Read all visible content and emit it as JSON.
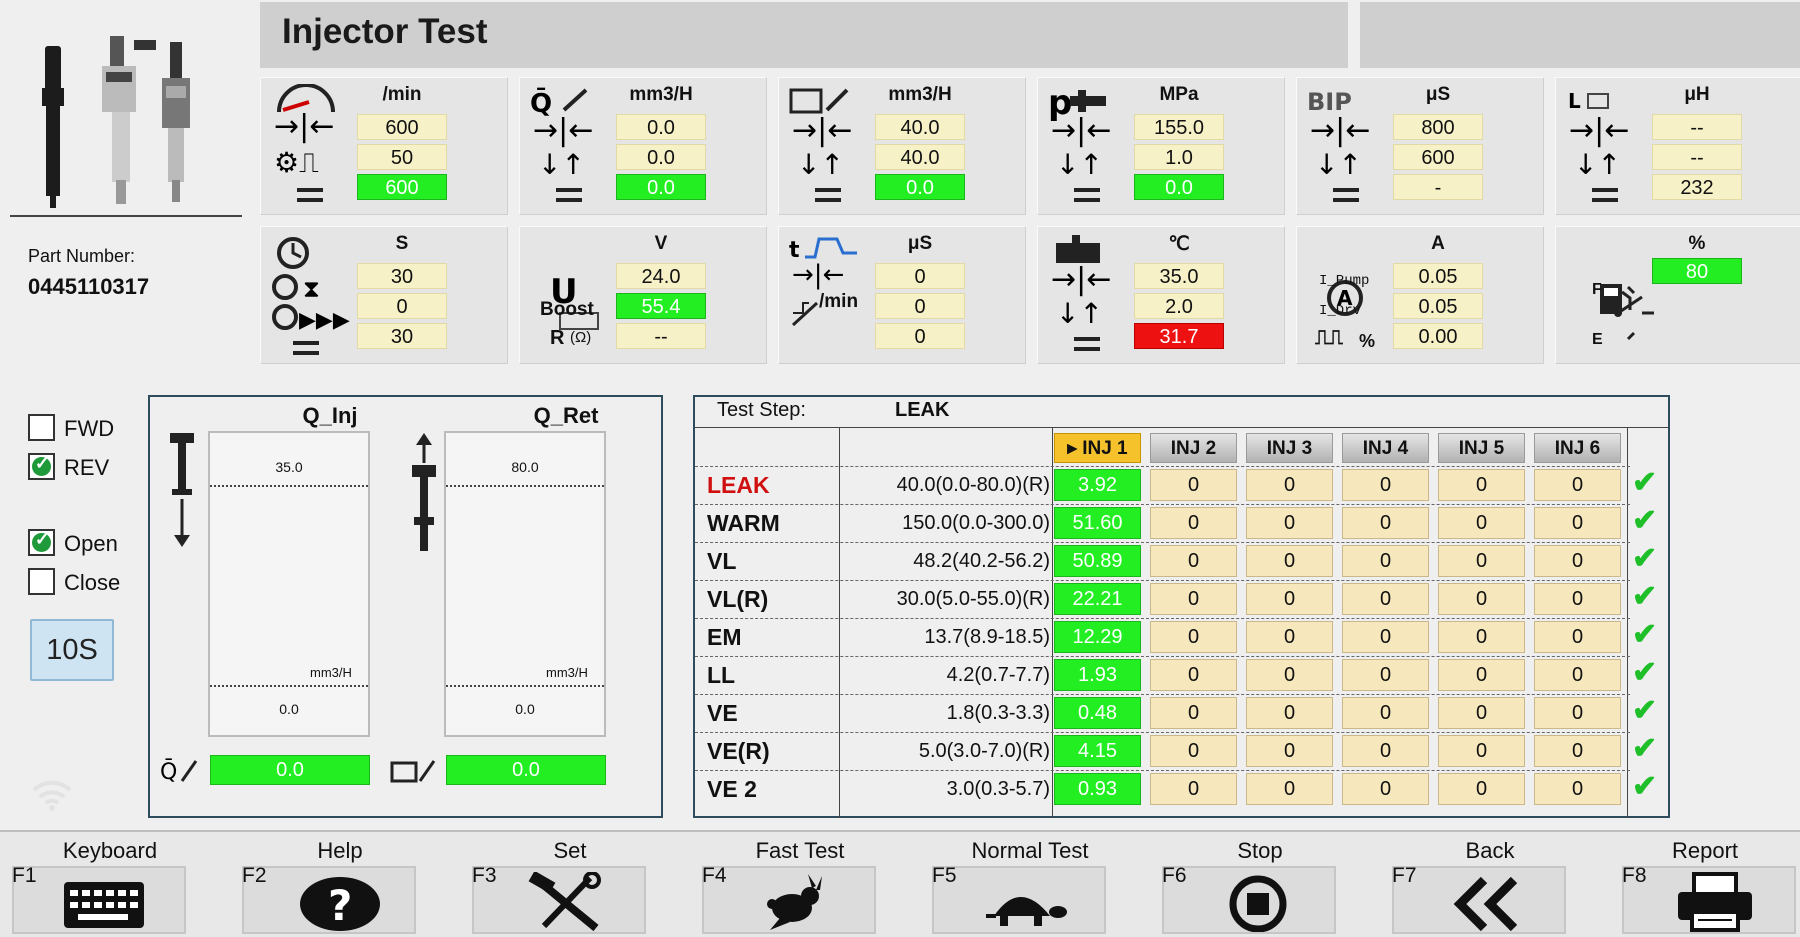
{
  "header": {
    "title": "Injector Test"
  },
  "part": {
    "label": "Part Number:",
    "value": "0445110317"
  },
  "panels_row1": [
    {
      "id": "speed",
      "unit": "/min",
      "values": [
        "600",
        "50",
        "600"
      ],
      "third": "green"
    },
    {
      "id": "qinj",
      "unit": "mm3/H",
      "values": [
        "0.0",
        "0.0",
        "0.0"
      ],
      "third": "green"
    },
    {
      "id": "qret",
      "unit": "mm3/H",
      "values": [
        "40.0",
        "40.0",
        "0.0"
      ],
      "third": "green"
    },
    {
      "id": "pressure",
      "unit": "MPa",
      "values": [
        "155.0",
        "1.0",
        "0.0"
      ],
      "third": "green"
    },
    {
      "id": "bip",
      "unit": "μS",
      "values": [
        "800",
        "600",
        "-"
      ],
      "third": "plain"
    },
    {
      "id": "inductance",
      "unit": "μH",
      "values": [
        "--",
        "--",
        "232"
      ],
      "third": "plain"
    }
  ],
  "panels_row2": [
    {
      "id": "time",
      "unit": "S",
      "values": [
        "30",
        "0",
        "30"
      ]
    },
    {
      "id": "voltage",
      "unit": "V",
      "values": [
        "24.0",
        "55.4",
        "--"
      ],
      "labels": {
        "boost": "Boost",
        "r": "R"
      }
    },
    {
      "id": "pulse",
      "unit": "μS",
      "values": [
        "0",
        "0",
        "0"
      ],
      "labels": {
        "min": "/min"
      }
    },
    {
      "id": "temperature",
      "unit": "℃",
      "values": [
        "35.0",
        "2.0",
        "31.7"
      ]
    },
    {
      "id": "current",
      "unit": "A",
      "values": [
        "0.05",
        "0.05",
        "0.00"
      ],
      "labels": {
        "ipump": "I_Pump",
        "idrv": "I_Drv",
        "duty": "%"
      }
    },
    {
      "id": "fuel",
      "unit": "%",
      "values": [
        "80"
      ],
      "labels": {
        "f": "F",
        "e": "E"
      }
    }
  ],
  "direction": {
    "fwd": "FWD",
    "rev": "REV",
    "fwd_checked": false,
    "rev_checked": true
  },
  "valve": {
    "open": "Open",
    "close": "Close",
    "open_checked": true,
    "close_checked": false
  },
  "timer_button": "10S",
  "flow": {
    "inj": {
      "title": "Q_Inj",
      "max": "35.0",
      "min": "0.0",
      "unit": "mm3/H",
      "value": "0.0"
    },
    "ret": {
      "title": "Q_Ret",
      "max": "80.0",
      "min": "0.0",
      "unit": "mm3/H",
      "value": "0.0"
    }
  },
  "table": {
    "step_label": "Test Step:",
    "step_value": "LEAK",
    "columns": [
      "INJ 1",
      "INJ 2",
      "INJ 3",
      "INJ 4",
      "INJ 5",
      "INJ 6"
    ],
    "rows": [
      {
        "name": "LEAK",
        "std": "40.0(0.0-80.0)(R)",
        "inj1": "3.92",
        "others": [
          "0",
          "0",
          "0",
          "0",
          "0"
        ]
      },
      {
        "name": "WARM",
        "std": "150.0(0.0-300.0)",
        "inj1": "51.60",
        "others": [
          "0",
          "0",
          "0",
          "0",
          "0"
        ]
      },
      {
        "name": "VL",
        "std": "48.2(40.2-56.2)",
        "inj1": "50.89",
        "others": [
          "0",
          "0",
          "0",
          "0",
          "0"
        ]
      },
      {
        "name": "VL(R)",
        "std": "30.0(5.0-55.0)(R)",
        "inj1": "22.21",
        "others": [
          "0",
          "0",
          "0",
          "0",
          "0"
        ]
      },
      {
        "name": "EM",
        "std": "13.7(8.9-18.5)",
        "inj1": "12.29",
        "others": [
          "0",
          "0",
          "0",
          "0",
          "0"
        ]
      },
      {
        "name": "LL",
        "std": "4.2(0.7-7.7)",
        "inj1": "1.93",
        "others": [
          "0",
          "0",
          "0",
          "0",
          "0"
        ]
      },
      {
        "name": "VE",
        "std": "1.8(0.3-3.3)",
        "inj1": "0.48",
        "others": [
          "0",
          "0",
          "0",
          "0",
          "0"
        ]
      },
      {
        "name": "VE(R)",
        "std": "5.0(3.0-7.0)(R)",
        "inj1": "4.15",
        "others": [
          "0",
          "0",
          "0",
          "0",
          "0"
        ]
      },
      {
        "name": "VE 2",
        "std": "3.0(0.3-5.7)",
        "inj1": "0.93",
        "others": [
          "0",
          "0",
          "0",
          "0",
          "0"
        ]
      }
    ]
  },
  "footer": [
    {
      "key": "F1",
      "label": "Keyboard",
      "icon": "keyboard-icon"
    },
    {
      "key": "F2",
      "label": "Help",
      "icon": "help-icon"
    },
    {
      "key": "F3",
      "label": "Set",
      "icon": "tools-icon"
    },
    {
      "key": "F4",
      "label": "Fast Test",
      "icon": "rabbit-icon"
    },
    {
      "key": "F5",
      "label": "Normal Test",
      "icon": "turtle-icon"
    },
    {
      "key": "F6",
      "label": "Stop",
      "icon": "stop-icon"
    },
    {
      "key": "F7",
      "label": "Back",
      "icon": "back-icon"
    },
    {
      "key": "F8",
      "label": "Report",
      "icon": "printer-icon"
    }
  ],
  "colors": {
    "ok": "#22ee22",
    "alarm": "#ee1111",
    "cell": "#f7f1c8",
    "active_tab": "#f6c22c"
  }
}
